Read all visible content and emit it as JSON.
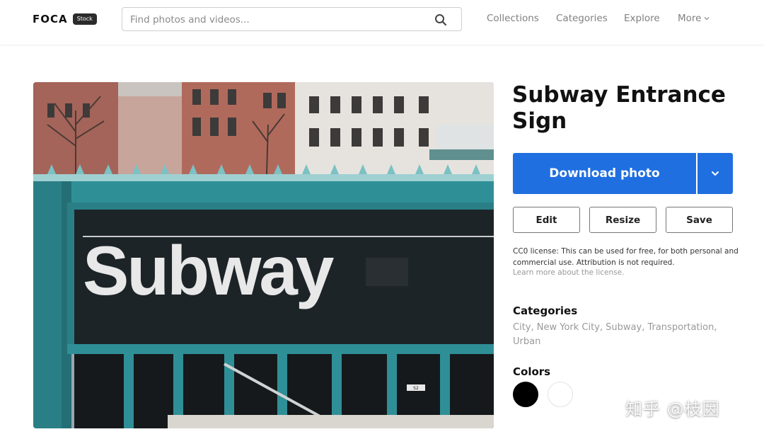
{
  "header": {
    "logo_text": "FOCA",
    "logo_badge": "Stock",
    "search_placeholder": "Find photos and videos...",
    "nav": [
      "Collections",
      "Categories",
      "Explore",
      "More"
    ]
  },
  "photo": {
    "sign_text": "Subway",
    "plate_text": "S2"
  },
  "detail": {
    "title": "Subway Entrance Sign",
    "download_label": "Download photo",
    "actions": [
      "Edit",
      "Resize",
      "Save"
    ],
    "license_text": "CC0 license: This can be used for free, for both personal and commercial use. Attribution is not required.",
    "license_link": "Learn more about the license.",
    "categories_heading": "Categories",
    "categories": [
      "City",
      "New York City",
      "Subway",
      "Transportation",
      "Urban"
    ],
    "colors_heading": "Colors",
    "colors": [
      "#000000",
      "#ffffff"
    ]
  },
  "watermark": "知乎 @枝因",
  "theme": {
    "primary": "#1f6fe0",
    "teal": "#2f8f97"
  }
}
